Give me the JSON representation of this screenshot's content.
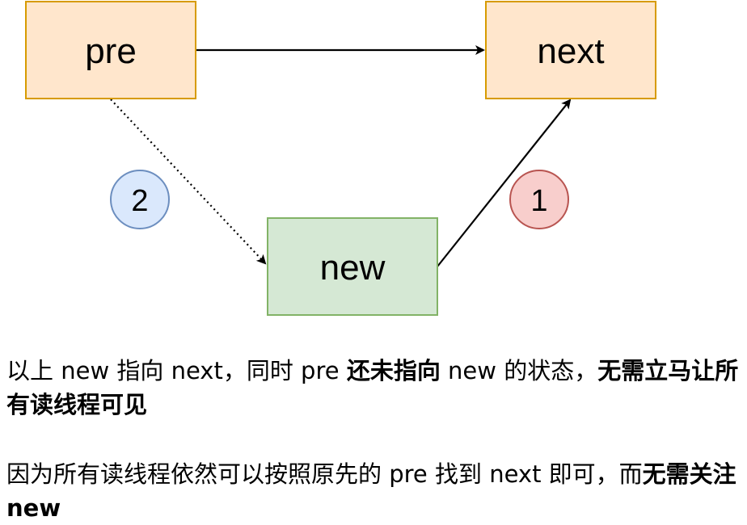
{
  "nodes": {
    "pre": {
      "label": "pre",
      "fill": "#ffe6cc",
      "stroke": "#d79b00"
    },
    "next": {
      "label": "next",
      "fill": "#ffe6cc",
      "stroke": "#d79b00"
    },
    "new": {
      "label": "new",
      "fill": "#d5e8d4",
      "stroke": "#82b366"
    }
  },
  "badges": {
    "step1": {
      "label": "1",
      "fill": "#f8cecc",
      "stroke": "#b85450"
    },
    "step2": {
      "label": "2",
      "fill": "#dae8fc",
      "stroke": "#6c8ebf"
    }
  },
  "edges": [
    {
      "from": "pre",
      "to": "next",
      "style": "solid"
    },
    {
      "from": "new",
      "to": "next",
      "style": "solid",
      "step": "1"
    },
    {
      "from": "pre",
      "to": "new",
      "style": "dotted",
      "step": "2"
    }
  ],
  "caption1": {
    "p1": "以上 new 指向 next，同时 pre ",
    "b1": "还未指向",
    "p2": " new 的状态，",
    "b2": "无需立马让所有读线程可见"
  },
  "caption2": {
    "p1": "因为所有读线程依然可以按照原先的 pre 找到 next 即可，而",
    "b1": "无需关注 new"
  }
}
